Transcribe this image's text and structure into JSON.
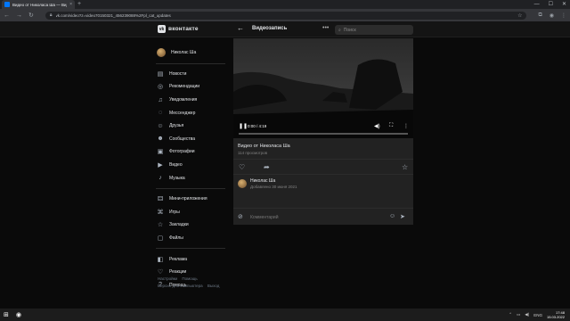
{
  "browser": {
    "tab_title": "Видео от Николаса Ша — Видео",
    "tab_close": "×",
    "new_tab": "+",
    "url": "vk.com/video?z=video70150321_456239088%2Fpl_cat_updates",
    "nav_back": "←",
    "nav_forward": "→",
    "nav_reload": "↻",
    "window_controls": [
      "—",
      "☐",
      "✕"
    ]
  },
  "header": {
    "logo_text": "вконтакте",
    "logo_mark": "vk",
    "page_title": "Видеозапись",
    "back_icon": "←",
    "more_icon": "•••",
    "search_placeholder": "Поиск"
  },
  "sidebar": {
    "items": [
      {
        "label": "Николас Ша",
        "icon": "avatar"
      },
      {
        "label": "Новости",
        "icon": "newspaper-icon",
        "glyph": "▤"
      },
      {
        "label": "Рекомендации",
        "icon": "rocket-icon",
        "glyph": "◎"
      },
      {
        "label": "Уведомления",
        "icon": "bell-icon",
        "glyph": "♫"
      },
      {
        "label": "Мессенджер",
        "icon": "message-icon",
        "glyph": "◌"
      },
      {
        "label": "Друзья",
        "icon": "user-icon",
        "glyph": "☺"
      },
      {
        "label": "Сообщества",
        "icon": "users-icon",
        "glyph": "☻"
      },
      {
        "label": "Фотографии",
        "icon": "camera-icon",
        "glyph": "▣"
      },
      {
        "label": "Видео",
        "icon": "video-icon",
        "glyph": "▶"
      },
      {
        "label": "Музыка",
        "icon": "music-icon",
        "glyph": "♪"
      },
      {
        "label": "Мини-приложения",
        "icon": "apps-icon",
        "glyph": "⚃"
      },
      {
        "label": "Игры",
        "icon": "gamepad-icon",
        "glyph": "⌘"
      },
      {
        "label": "Закладки",
        "icon": "bookmark-icon",
        "glyph": "☆"
      },
      {
        "label": "Файлы",
        "icon": "file-icon",
        "glyph": "▢"
      },
      {
        "label": "Реклама",
        "icon": "megaphone-icon",
        "glyph": "◧"
      },
      {
        "label": "Реакции",
        "icon": "heart-icon",
        "glyph": "♡"
      },
      {
        "label": "Помощь",
        "icon": "help-icon",
        "glyph": "?"
      }
    ],
    "footer_links": [
      "Настройки",
      "Помощь",
      "Версия для компьютера",
      "Выход"
    ]
  },
  "video": {
    "timecode": "0:00 / 4:19",
    "progress_fraction": 0,
    "title": "Видео от Николаса Ша",
    "views": "114 просмотров",
    "author_name": "Николас Ша",
    "date": "Добавлено 30 июня 2021",
    "comment_placeholder": "Комментарий"
  },
  "icons": {
    "play": "❚❚",
    "volume": "◀)",
    "fullscreen": "⛶",
    "more": "⋮",
    "like": "♡",
    "share": "➦",
    "bookmark": "☆",
    "attach": "⊘",
    "emoji": "☺",
    "send": "➤"
  },
  "taskbar": {
    "clock_time": "17:48",
    "clock_date": "15.03.2022",
    "language": "ENG"
  },
  "colors": {
    "background": "#0a0a0a",
    "card": "#222222",
    "accent": "#0077ff"
  }
}
